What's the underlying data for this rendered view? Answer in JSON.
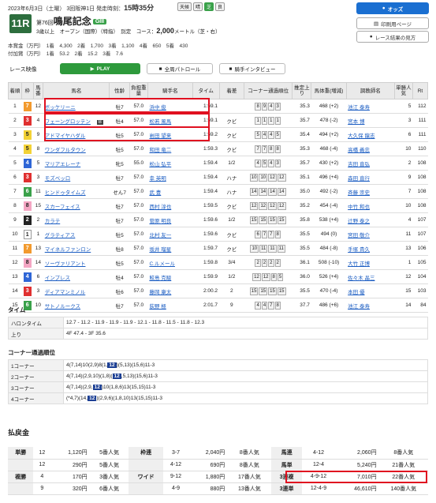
{
  "header": {
    "date": "2023年6月3日（土曜）",
    "kai": "3回阪神1日",
    "post_label": "発走時刻：",
    "post_time": "15時35分",
    "weather": [
      "天候",
      "晴",
      "芝",
      "良"
    ],
    "race_no": "11R",
    "edition": "第76回",
    "race_name": "鳴尾記念",
    "grade": "GIII",
    "conditions": "3歳以上　オープン（国際）（特指）　別定　コース：",
    "distance": "2,000",
    "unit": "メートル（芝・右）",
    "prize_1": "本賞金（万円）　1着　4,300　2着　1,700　3着　1,100　4着　650　5着　430",
    "prize_2": "付加賞（万円）　1着　53.2　2着　15.2　3着　7.6"
  },
  "side_buttons": {
    "odds": "オッズ",
    "print": "印刷用ページ",
    "back": "レース結果の見方"
  },
  "toolbar": {
    "video": "レース映像",
    "play": "PLAY",
    "patrol": "全周パトロール",
    "interview": "騎手インタビュー"
  },
  "table": {
    "headers": [
      "着順",
      "枠",
      "馬番",
      "馬名",
      "性齢",
      "負担重量",
      "騎手名",
      "タイム",
      "着差",
      "コーナー通過順位",
      "推定上り",
      "馬体重(増減)",
      "調教師名",
      "単勝人気",
      "Rt"
    ],
    "rows": [
      [
        "1",
        "7",
        "12",
        "ボッケリーニ",
        "牡7",
        "57.0",
        "浜中 俊",
        "1:59.1",
        "",
        "8 9 4 3",
        "35.3",
        "468 (+2)",
        "池江 泰寿",
        "5",
        "112"
      ],
      [
        "2",
        "3",
        "4",
        "フェーングロッテン",
        "牡4",
        "57.0",
        "松若 風馬",
        "1:59.1",
        "クビ",
        "1 1 1 1",
        "35.7",
        "478 (-2)",
        "宮本 博",
        "3",
        "111"
      ],
      [
        "3",
        "5",
        "9",
        "アドマイヤハダル",
        "牡5",
        "57.0",
        "岩田 望来",
        "1:59.2",
        "クビ",
        "5 4 4 5",
        "35.4",
        "494 (+2)",
        "大久保 龍志",
        "6",
        "111"
      ],
      [
        "4",
        "5",
        "8",
        "ワンダフルタウン",
        "牡5",
        "57.0",
        "和田 竜二",
        "1:59.3",
        "クビ",
        "7 7 8 8",
        "35.3",
        "468 (-4)",
        "高橋 義忠",
        "10",
        "110"
      ],
      [
        "5",
        "4",
        "5",
        "マリアエレーナ",
        "牝5",
        "55.0",
        "松山 弘平",
        "1:59.4",
        "1/2",
        "4 5 4 3",
        "35.7",
        "430 (+2)",
        "吉田 直弘",
        "2",
        "108"
      ],
      [
        "6",
        "3",
        "3",
        "モズベッロ",
        "牡7",
        "57.0",
        "幸 英明",
        "1:59.4",
        "ハナ",
        "10 10 12 12",
        "35.1",
        "496 (+4)",
        "森田 直行",
        "9",
        "108"
      ],
      [
        "7",
        "6",
        "11",
        "ヒンドゥタイムズ",
        "せん7",
        "57.0",
        "武 豊",
        "1:59.4",
        "ハナ",
        "14 14 14 14",
        "35.0",
        "492 (-2)",
        "斉藤 崇史",
        "7",
        "108"
      ],
      [
        "8",
        "8",
        "15",
        "スカーフェイス",
        "牡7",
        "57.0",
        "西村 淳也",
        "1:59.5",
        "クビ",
        "12 12 12 12",
        "35.2",
        "454 (-4)",
        "中竹 和也",
        "10",
        "108"
      ],
      [
        "9",
        "2",
        "2",
        "カラテ",
        "牡7",
        "57.0",
        "菅原 明良",
        "1:59.6",
        "1/2",
        "15 15 15 15",
        "35.8",
        "538 (+4)",
        "辻野 泰之",
        "4",
        "107"
      ],
      [
        "10",
        "1",
        "1",
        "グラティアス",
        "牡5",
        "57.0",
        "北村 友一",
        "1:59.6",
        "クビ",
        "6 7 7 8",
        "35.5",
        "494 (0)",
        "宮田 敬介",
        "11",
        "107"
      ],
      [
        "11",
        "7",
        "13",
        "マイネルファンロン",
        "牡8",
        "57.0",
        "坂井 瑠星",
        "1:59.7",
        "クビ",
        "10 11 11 11",
        "35.5",
        "484 (-8)",
        "手塚 貴久",
        "13",
        "106"
      ],
      [
        "12",
        "8",
        "14",
        "ソーヴァリアント",
        "牡5",
        "57.0",
        "C.ルメール",
        "1:59.8",
        "3/4",
        "2 2 2 2",
        "36.1",
        "508 (-10)",
        "大竹 正博",
        "1",
        "105"
      ],
      [
        "13",
        "4",
        "6",
        "インプレス",
        "牡4",
        "57.0",
        "鮫島 克駿",
        "1:59.9",
        "1/2",
        "12 12 8 5",
        "36.0",
        "526 (+4)",
        "佐々木 晶三",
        "12",
        "104"
      ],
      [
        "14",
        "3",
        "3",
        "ディアマンミノル",
        "牡6",
        "57.0",
        "藤岡 康太",
        "2:00.2",
        "2",
        "15 15 15 15",
        "35.5",
        "470 (-4)",
        "本田 優",
        "15",
        "103"
      ],
      [
        "15",
        "6",
        "10",
        "サトノルークス",
        "牡7",
        "57.0",
        "荻野 極",
        "2:01.7",
        "9",
        "4 4 7 8",
        "37.7",
        "486 (+6)",
        "池江 泰寿",
        "14",
        "84"
      ]
    ]
  },
  "blinker": "B",
  "time": {
    "title": "タイム",
    "lap_label": "ハロンタイム",
    "lap": "12.7 - 11.2 - 11.9 - 11.9 - 11.9 - 12.1 - 11.8 - 11.5 - 11.8 - 12.3",
    "agari_label": "上り",
    "agari": "4F 47.4 - 3F 35.6"
  },
  "corners": {
    "title": "コーナー通過順位",
    "rows": [
      {
        "label": "1コーナー",
        "pre": "4(7,14)10(2,9)8(1,",
        "hl": "12",
        "post": ")(5,13)(15,6)11-3"
      },
      {
        "label": "2コーナー",
        "pre": "4(7,14)(2,9,10)(1,8)(",
        "hl": "12",
        "post": ",5,13)(15,6)11-3"
      },
      {
        "label": "3コーナー",
        "pre": "4(7,14)(2,9,",
        "hl": "12",
        "post": ")10(1,8,6)13(15,15)11-3"
      },
      {
        "label": "4コーナー",
        "pre": "(*4,7)(14,",
        "hl": "12",
        "post": ")(2,9,6)(1,8,10)13(15,15)11-3"
      }
    ]
  },
  "payout": {
    "title": "払戻金",
    "rows": [
      [
        "単勝",
        "12",
        "1,120円",
        "5番人気",
        "枠連",
        "3-7",
        "2,040円",
        "8番人気",
        "馬連",
        "4-12",
        "2,060円",
        "8番人気"
      ],
      [
        "",
        "12",
        "290円",
        "5番人気",
        "",
        "4-12",
        "690円",
        "8番人気",
        "馬単",
        "12-4",
        "5,240円",
        "21番人気"
      ],
      [
        "複勝",
        "4",
        "170円",
        "3番人気",
        "ワイド",
        "9-12",
        "1,880円",
        "17番人気",
        "3連複",
        "4-9-12",
        "7,010円",
        "22番人気"
      ],
      [
        "",
        "9",
        "320円",
        "6番人気",
        "",
        "4-9",
        "880円",
        "13番人気",
        "3連単",
        "12-4-9",
        "46,610円",
        "140番人気"
      ]
    ]
  }
}
